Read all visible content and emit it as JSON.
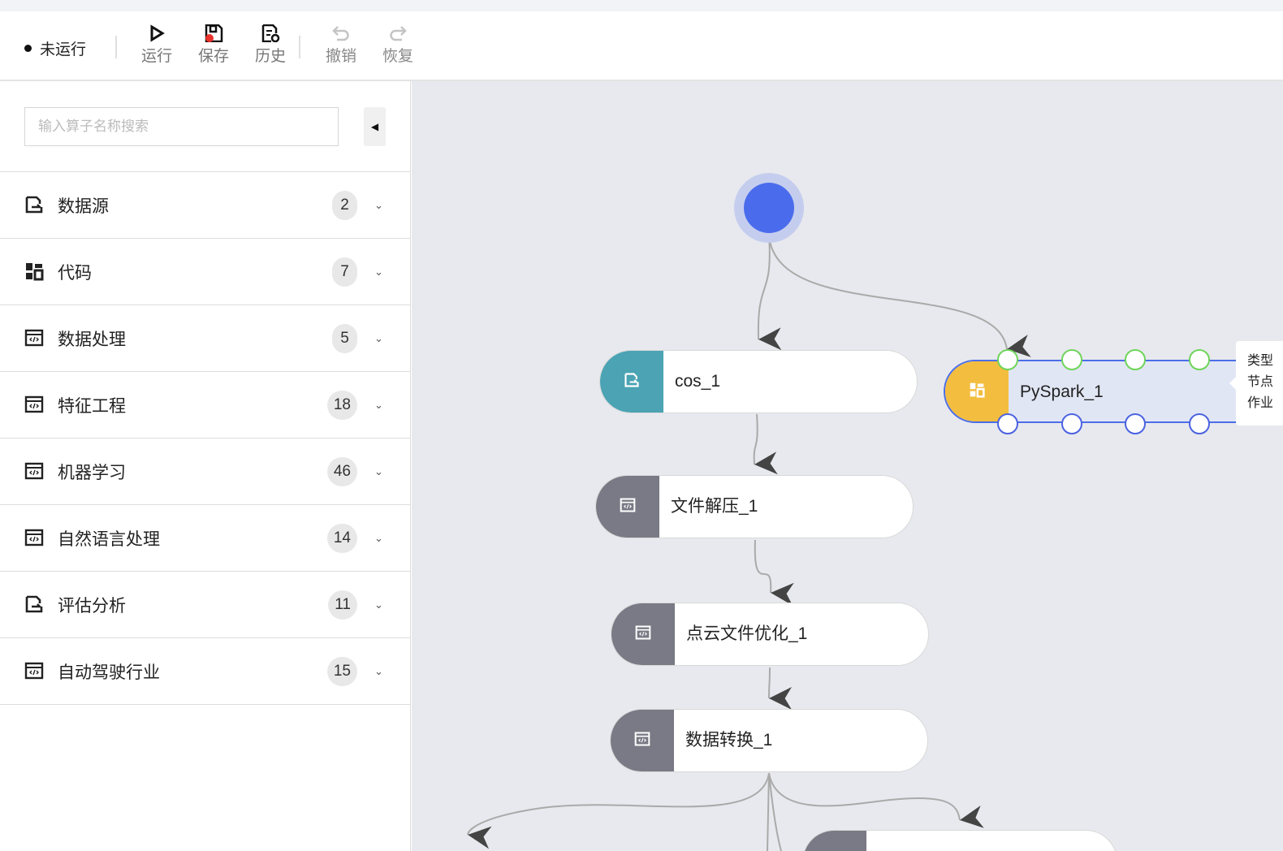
{
  "toolbar": {
    "status": "未运行",
    "run": "运行",
    "save": "保存",
    "history": "历史",
    "undo": "撤销",
    "redo": "恢复"
  },
  "sidebar": {
    "search_placeholder": "输入算子名称搜索",
    "categories": [
      {
        "label": "数据源",
        "count": "2",
        "icon": "datasource-icon"
      },
      {
        "label": "代码",
        "count": "7",
        "icon": "code-icon"
      },
      {
        "label": "数据处理",
        "count": "5",
        "icon": "window-code-icon"
      },
      {
        "label": "特征工程",
        "count": "18",
        "icon": "window-code-icon"
      },
      {
        "label": "机器学习",
        "count": "46",
        "icon": "window-code-icon"
      },
      {
        "label": "自然语言处理",
        "count": "14",
        "icon": "window-code-icon"
      },
      {
        "label": "评估分析",
        "count": "11",
        "icon": "datasource-icon"
      },
      {
        "label": "自动驾驶行业",
        "count": "15",
        "icon": "window-code-icon"
      }
    ]
  },
  "canvas": {
    "nodes": [
      {
        "name": "cos_1",
        "color": "#4ba3b3"
      },
      {
        "name": "文件解压_1",
        "color": "#7a7a86"
      },
      {
        "name": "点云文件优化_1",
        "color": "#7a7a86"
      },
      {
        "name": "数据转换_1",
        "color": "#7a7a86"
      },
      {
        "name": "PySpark_1",
        "color": "#f3bd3f"
      }
    ],
    "tooltip": [
      "类型",
      "节点",
      "作业"
    ]
  }
}
